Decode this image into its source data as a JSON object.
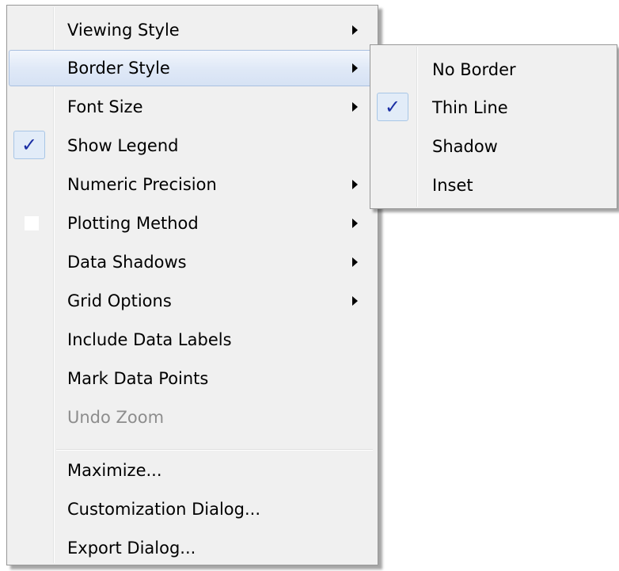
{
  "context_menu": {
    "items": [
      {
        "label": "Viewing Style",
        "has_submenu": true
      },
      {
        "label": "Border Style",
        "has_submenu": true,
        "highlighted": true
      },
      {
        "label": "Font Size",
        "has_submenu": true
      },
      {
        "label": "Show Legend",
        "checked": true
      },
      {
        "label": "Numeric Precision",
        "has_submenu": true
      },
      {
        "label": "Plotting Method",
        "has_submenu": true
      },
      {
        "label": "Data Shadows",
        "has_submenu": true
      },
      {
        "label": "Grid Options",
        "has_submenu": true
      },
      {
        "label": "Include Data Labels"
      },
      {
        "label": "Mark Data Points"
      },
      {
        "label": "Undo Zoom",
        "disabled": true
      },
      {
        "label": "Maximize..."
      },
      {
        "label": "Customization Dialog..."
      },
      {
        "label": "Export Dialog..."
      }
    ]
  },
  "border_style_submenu": {
    "items": [
      {
        "label": "No Border"
      },
      {
        "label": "Thin Line",
        "checked": true
      },
      {
        "label": "Shadow"
      },
      {
        "label": "Inset"
      }
    ]
  },
  "icons": {
    "check": "✓",
    "submenu_arrow": "triangle-right-icon"
  },
  "colors": {
    "menu_background": "#f0f0f0",
    "highlight_border": "#a9c0e0",
    "check_color": "#1b2fa4",
    "disabled_text": "#8d8d8d"
  }
}
